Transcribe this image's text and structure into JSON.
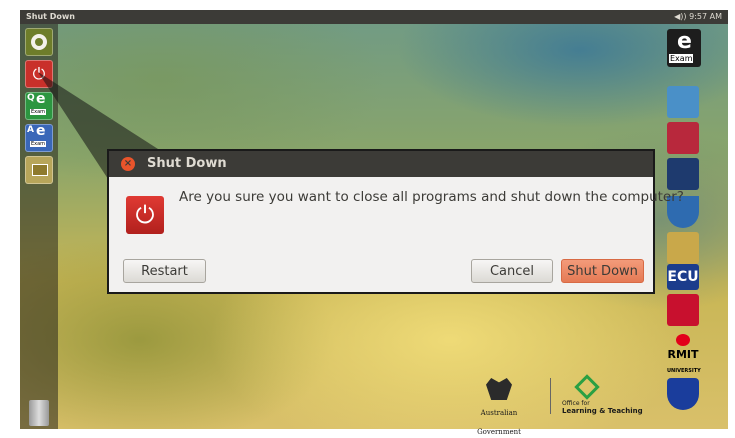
{
  "topbar": {
    "title": "Shut Down",
    "volume_icon": "speaker-icon",
    "time": "9:57 AM"
  },
  "launcher": {
    "items": [
      {
        "name": "ubuntu-home",
        "icon": "ubuntu-logo-icon"
      },
      {
        "name": "shutdown",
        "icon": "power-icon",
        "glyph": "⏻"
      },
      {
        "name": "q-exam",
        "tag": "Q",
        "letter": "e",
        "sub": "Exam"
      },
      {
        "name": "a-exam",
        "tag": "A",
        "letter": "e",
        "sub": "Exam"
      },
      {
        "name": "files",
        "icon": "files-icon"
      },
      {
        "name": "trash",
        "icon": "trash-icon"
      }
    ]
  },
  "dialog": {
    "title": "Shut Down",
    "close_glyph": "×",
    "icon_glyph": "⏻",
    "message": "Are you sure you want to close all programs and shut down the computer?",
    "buttons": {
      "restart": "Restart",
      "cancel": "Cancel",
      "shutdown": "Shut Down"
    }
  },
  "desktop": {
    "exam_logo": {
      "letter": "e",
      "word": "Exam"
    },
    "university_logos": [
      {
        "name": "uni-logo-1",
        "color": "#4a90c8"
      },
      {
        "name": "uni-logo-2",
        "color": "#b8283c"
      },
      {
        "name": "uni-logo-3",
        "color": "#1e3a6e"
      },
      {
        "name": "uni-logo-4",
        "color": "#2e6bb0"
      },
      {
        "name": "uni-logo-5",
        "color": "#c9a84a"
      },
      {
        "name": "ecu-logo",
        "text": "ECU"
      },
      {
        "name": "uni-logo-7",
        "color": "#c8102e"
      },
      {
        "name": "rmit-logo",
        "text": "RMIT",
        "sub": "UNIVERSITY"
      },
      {
        "name": "uni-logo-9",
        "color": "#1a3d9c"
      }
    ],
    "footer": {
      "gov": "Australian Government",
      "olt_prefix": "Office for",
      "olt_name": "Learning & Teaching"
    }
  }
}
